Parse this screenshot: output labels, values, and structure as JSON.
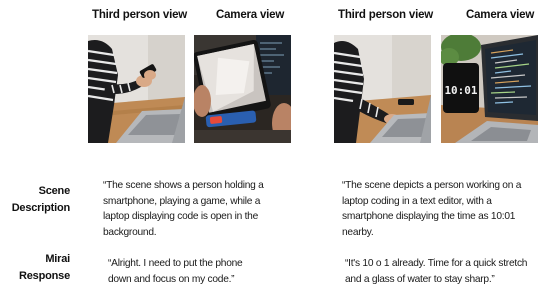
{
  "columns": [
    {
      "header": "Third person view"
    },
    {
      "header": "Camera view"
    },
    {
      "header": "Third person view"
    },
    {
      "header": "Camera view"
    }
  ],
  "rows": {
    "scene": {
      "label_line1": "Scene",
      "label_line2": "Description"
    },
    "mirai": {
      "label_line1": "Mirai",
      "label_line2": "Response"
    }
  },
  "examples": [
    {
      "scene_description": "“The scene shows a person holding a smartphone, playing a game, while a laptop displaying code is open in the background.",
      "mirai_response": "“Alright. I need to put the phone down and focus on my code.”"
    },
    {
      "scene_description": "“The scene depicts a person working on a laptop coding in a text editor, with a smartphone displaying the time as 10:01 nearby.",
      "mirai_response": "“It's 10 o 1 already. Time for a quick stretch and a glass of water to stay sharp.”"
    }
  ],
  "phone_clock_text": "10:01",
  "colors": {
    "wall": "#e3e0dc",
    "desk": "#c08a52",
    "sweater_dark": "#1b1b1d",
    "sweater_stripe": "#e8e8e8",
    "laptop": "#b9bbbe",
    "editor_bg": "#1f2a36",
    "plant": "#4f7d3a"
  }
}
